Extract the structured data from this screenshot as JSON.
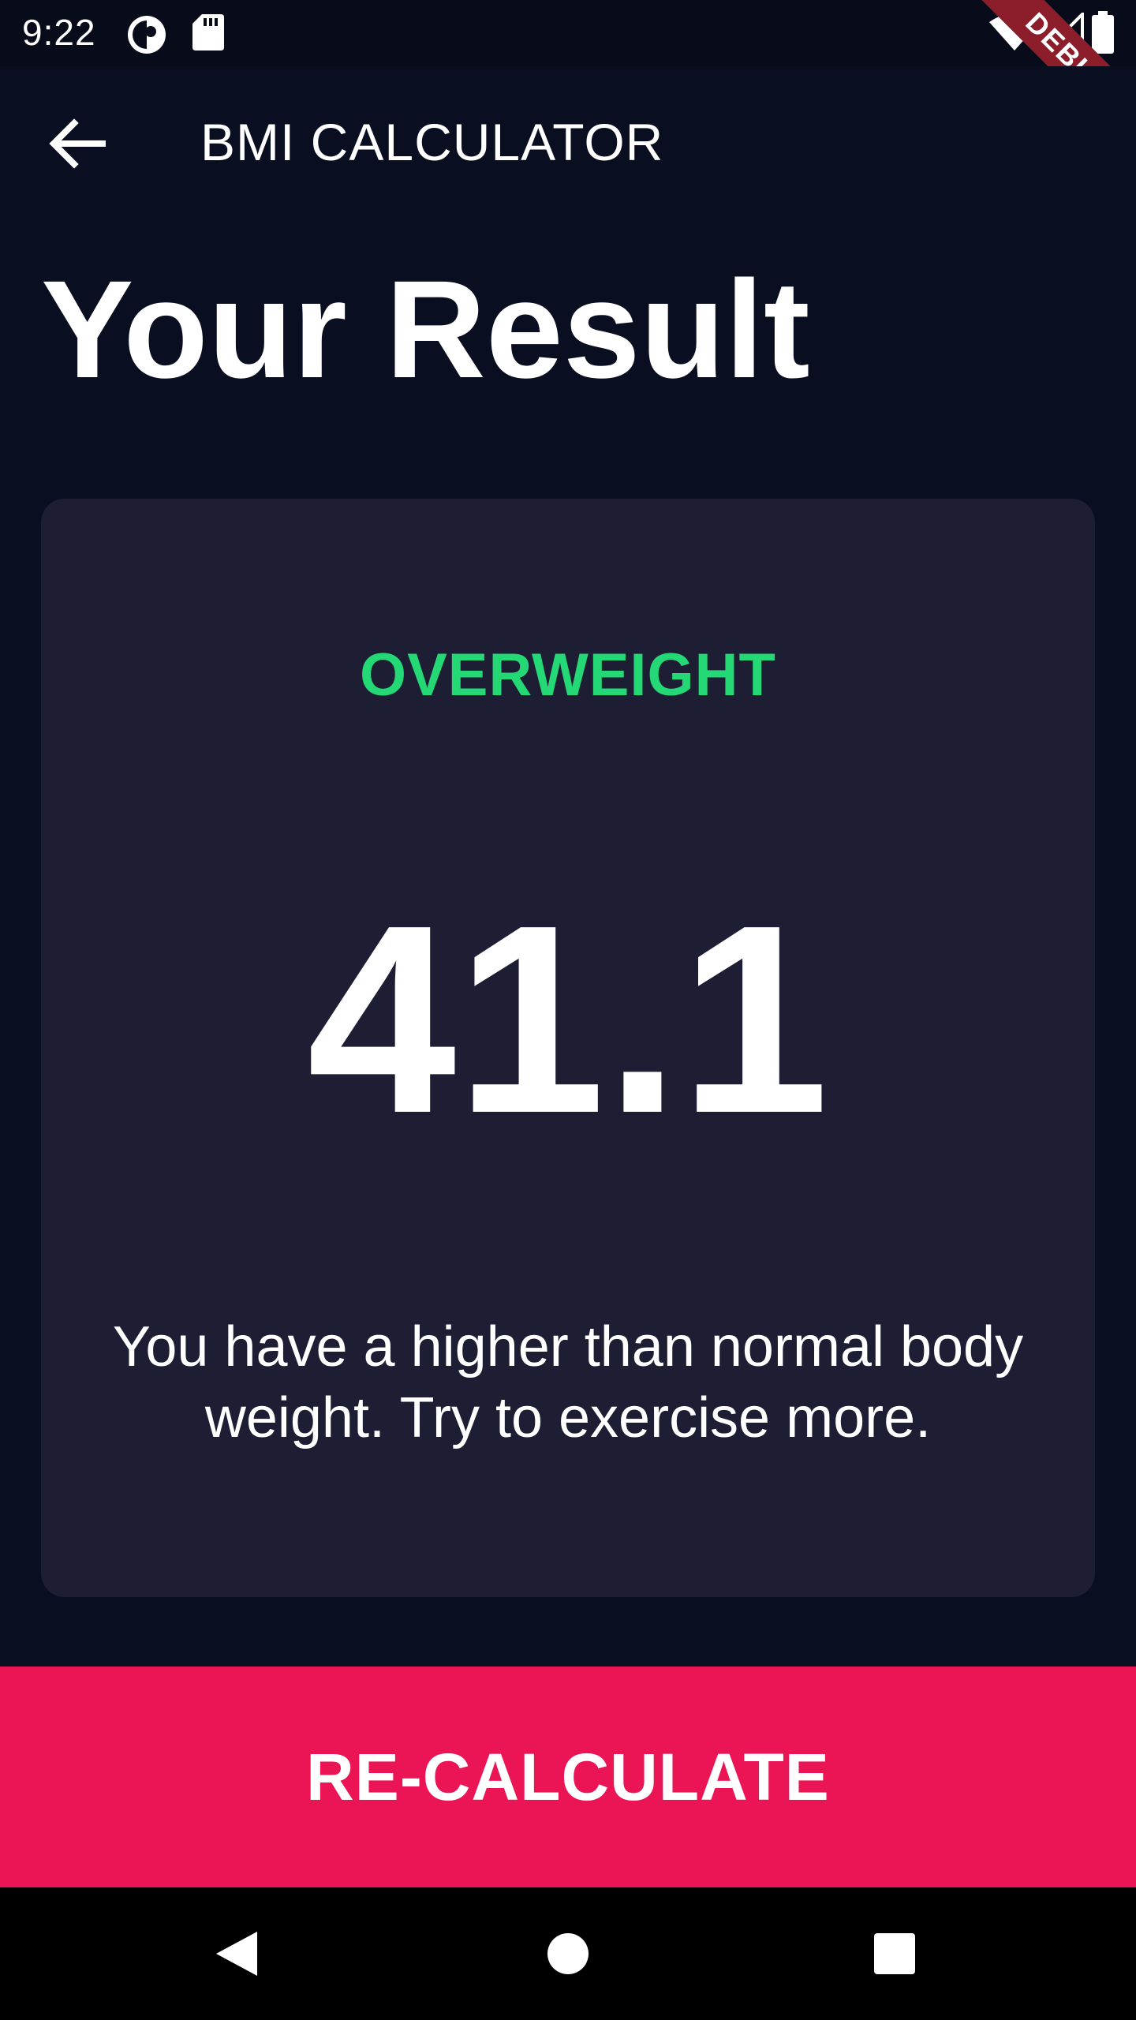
{
  "status_bar": {
    "time": "9:22",
    "icons": [
      "alarm-icon",
      "sd-card-icon",
      "wifi-icon",
      "signal-icon",
      "battery-icon"
    ]
  },
  "debug_banner": {
    "label": "DEBUG"
  },
  "app_bar": {
    "title": "BMI CALCULATOR",
    "back_icon": "arrow-back-icon"
  },
  "page": {
    "heading": "Your Result"
  },
  "result": {
    "status": "OVERWEIGHT",
    "value": "41.1",
    "message": "You have a higher than normal body weight. Try to exercise more."
  },
  "recalculate": {
    "label": "RE-CALCULATE"
  },
  "nav_bar": {
    "buttons": [
      "back-triangle-icon",
      "home-circle-icon",
      "recents-square-icon"
    ]
  },
  "colors": {
    "background": "#0a0e21",
    "card": "#1d1e33",
    "status_green": "#24d876",
    "accent_pink": "#eb1555",
    "debug_red": "#8b1e2a"
  }
}
